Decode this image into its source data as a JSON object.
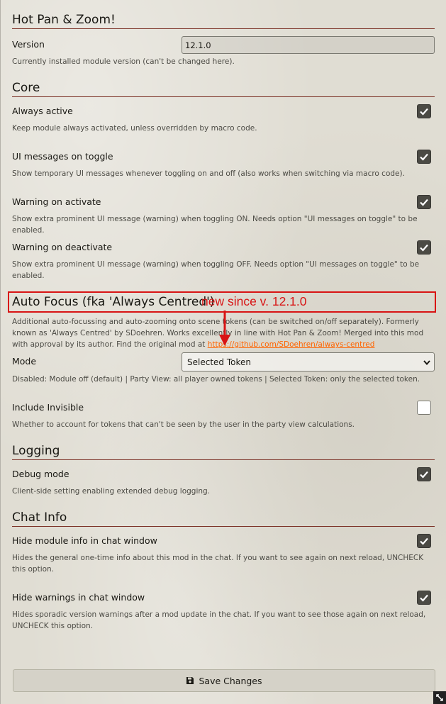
{
  "header": {
    "title": "Hot Pan & Zoom!"
  },
  "version": {
    "label": "Version",
    "value": "12.1.0",
    "hint": "Currently installed module version (can't be changed here)."
  },
  "core": {
    "title": "Core",
    "always_active": {
      "label": "Always active",
      "hint": "Keep module always activated, unless overridden by macro code.",
      "checked": true
    },
    "ui_messages": {
      "label": "UI messages on toggle",
      "hint": "Show temporary UI messages whenever toggling on and off (also works when switching via macro code).",
      "checked": true
    },
    "warning_activate": {
      "label": "Warning on activate",
      "hint": "Show extra prominent UI message (warning) when toggling ON. Needs option \"UI messages on toggle\" to be enabled.",
      "checked": true
    },
    "warning_deactivate": {
      "label": "Warning on deactivate",
      "hint": "Show extra prominent UI message (warning) when toggling OFF. Needs option \"UI messages on toggle\" to be enabled.",
      "checked": true
    }
  },
  "auto_focus": {
    "title": "Auto Focus (fka 'Always Centred')",
    "annotation": "new since v. 12.1.0",
    "hint_text": "Additional auto-focussing and auto-zooming onto scene tokens (can be switched on/off separately). Formerly known as 'Always Centred' by SDoehren. Works excellently in line with Hot Pan & Zoom! Merged into this mod with approval by its author. Find the original mod at ",
    "hint_link": "https://github.com/SDoehren/always-centred",
    "mode": {
      "label": "Mode",
      "selected": "Selected Token",
      "hint": "Disabled: Module off (default) | Party View: all player owned tokens | Selected Token: only the selected token."
    },
    "include_invisible": {
      "label": "Include Invisible",
      "hint": "Whether to account for tokens that can't be seen by the user in the party view calculations.",
      "checked": false
    }
  },
  "logging": {
    "title": "Logging",
    "debug": {
      "label": "Debug mode",
      "hint": "Client-side setting enabling extended debug logging.",
      "checked": true
    }
  },
  "chat_info": {
    "title": "Chat Info",
    "hide_info": {
      "label": "Hide module info in chat window",
      "hint": "Hides the general one-time info about this mod in the chat. If you want to see again on next reload, UNCHECK this option.",
      "checked": true
    },
    "hide_warnings": {
      "label": "Hide warnings in chat window",
      "hint": "Hides sporadic version warnings after a mod update in the chat. If you want to see those again on next reload, UNCHECK this option.",
      "checked": true
    }
  },
  "footer": {
    "save_label": "Save Changes"
  },
  "colors": {
    "accent_line": "#7a2f24",
    "annotation": "#d81414",
    "link": "#ff6400",
    "checkbox_on": "#4b4a44"
  }
}
